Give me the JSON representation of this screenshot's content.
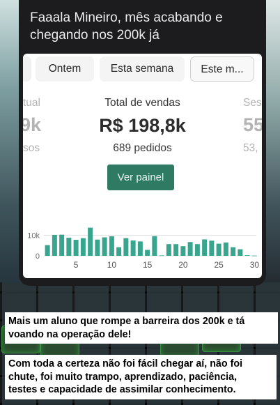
{
  "message": {
    "line1": "Faaala Mineiro, mês acabando e",
    "line2": "chegando nos 200k já"
  },
  "tabs": [
    {
      "label": "Ontem",
      "active": false
    },
    {
      "label": "Esta semana",
      "active": false
    },
    {
      "label": "Este m...",
      "active": true
    }
  ],
  "left_partial": {
    "title": "tual",
    "value": "9k",
    "sub": "sos"
  },
  "right_partial": {
    "title": "Ses",
    "value": "55",
    "sub": "53,"
  },
  "stats": {
    "title": "Total de vendas",
    "value": "R$ 198,8k",
    "orders": "689 pedidos",
    "button": "Ver painel"
  },
  "colors": {
    "accent": "#2f7a62",
    "bar": "#3aa58f"
  },
  "chart_data": {
    "type": "bar",
    "x_ticks": [
      "5",
      "10",
      "15",
      "20",
      "25",
      "30"
    ],
    "y_ticks": [
      "0",
      "10k"
    ],
    "ylim": [
      0,
      19000
    ],
    "x": [
      1,
      2,
      3,
      4,
      5,
      6,
      7,
      8,
      9,
      10,
      11,
      12,
      13,
      14,
      15,
      16,
      17,
      18,
      19,
      20,
      21,
      22,
      23,
      24,
      25,
      26,
      27,
      28,
      29,
      30
    ],
    "values": [
      5200,
      10200,
      10300,
      8800,
      7800,
      8600,
      13700,
      7900,
      9000,
      9500,
      4200,
      8600,
      7500,
      7000,
      2900,
      9600,
      200,
      5700,
      5700,
      4700,
      6700,
      5700,
      8000,
      7400,
      5900,
      6500,
      4200,
      3200,
      300,
      100
    ]
  },
  "captions": {
    "first_line1": "Mais um aluno que rompe a barreira dos 200k e tá",
    "first_line2": "voando na operação dele!",
    "second_line1": "Com toda a certeza não foi fácil chegar aí, não foi",
    "second_line2": "chute, foi muito trampo, aprendizado, paciência,",
    "second_line3": "testes e capacidade de assimilar conhecimento."
  }
}
